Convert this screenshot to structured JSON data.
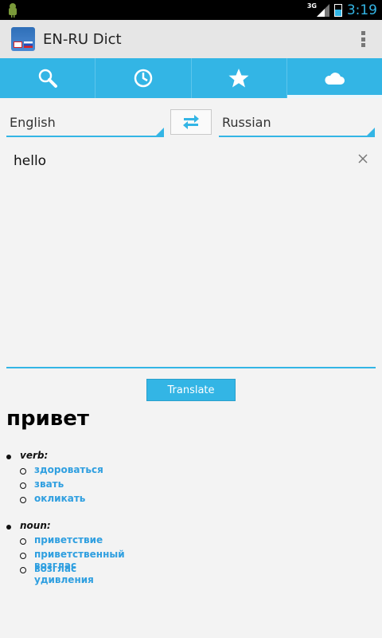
{
  "status_bar": {
    "time": "3:19",
    "network": "3G"
  },
  "action_bar": {
    "title": "EN-RU Dict"
  },
  "tabs": [
    {
      "icon": "search-icon"
    },
    {
      "icon": "history-icon"
    },
    {
      "icon": "star-icon"
    },
    {
      "icon": "cloud-icon",
      "selected": true
    }
  ],
  "languages": {
    "source": "English",
    "target": "Russian"
  },
  "input": {
    "value": "hello"
  },
  "translate_label": "Translate",
  "result": {
    "word": "привет",
    "groups": [
      {
        "pos": "verb:",
        "meanings": [
          "здороваться",
          "звать",
          "окликать"
        ]
      },
      {
        "pos": "noun:",
        "meanings": [
          "приветствие",
          "приветственный возглас",
          "возглас удивления"
        ]
      }
    ]
  },
  "colors": {
    "accent": "#33b5e5",
    "link": "#2f9fe0",
    "background": "#f3f3f3"
  }
}
